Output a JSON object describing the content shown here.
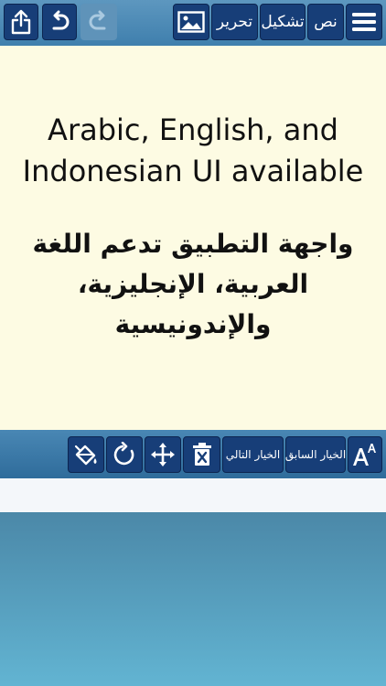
{
  "toolbar": {
    "text_label": "نص",
    "diacritics_label": "تشكيل",
    "edit_label": "تحرير"
  },
  "canvas": {
    "english_text": "Arabic, English, and Indonesian UI available",
    "arabic_text": "واجهة التطبيق تدعم اللغة العربية، الإنجليزية، والإندونيسية"
  },
  "bottom_toolbar": {
    "next_option_label": "الخيار التالي",
    "previous_option_label": "الخيار السابق"
  },
  "icons": {
    "share": "share-icon",
    "undo": "undo-icon",
    "redo": "redo-icon",
    "image": "image-icon",
    "menu": "menu-icon",
    "paint_bucket": "paint-bucket-icon",
    "rotate": "rotate-icon",
    "move": "move-icon",
    "delete": "delete-icon",
    "font_size": "font-size-icon"
  },
  "colors": {
    "button_bg": "#173e78",
    "canvas_bg": "#fdfbe3",
    "toolbar_bg": "#4a88b5"
  }
}
